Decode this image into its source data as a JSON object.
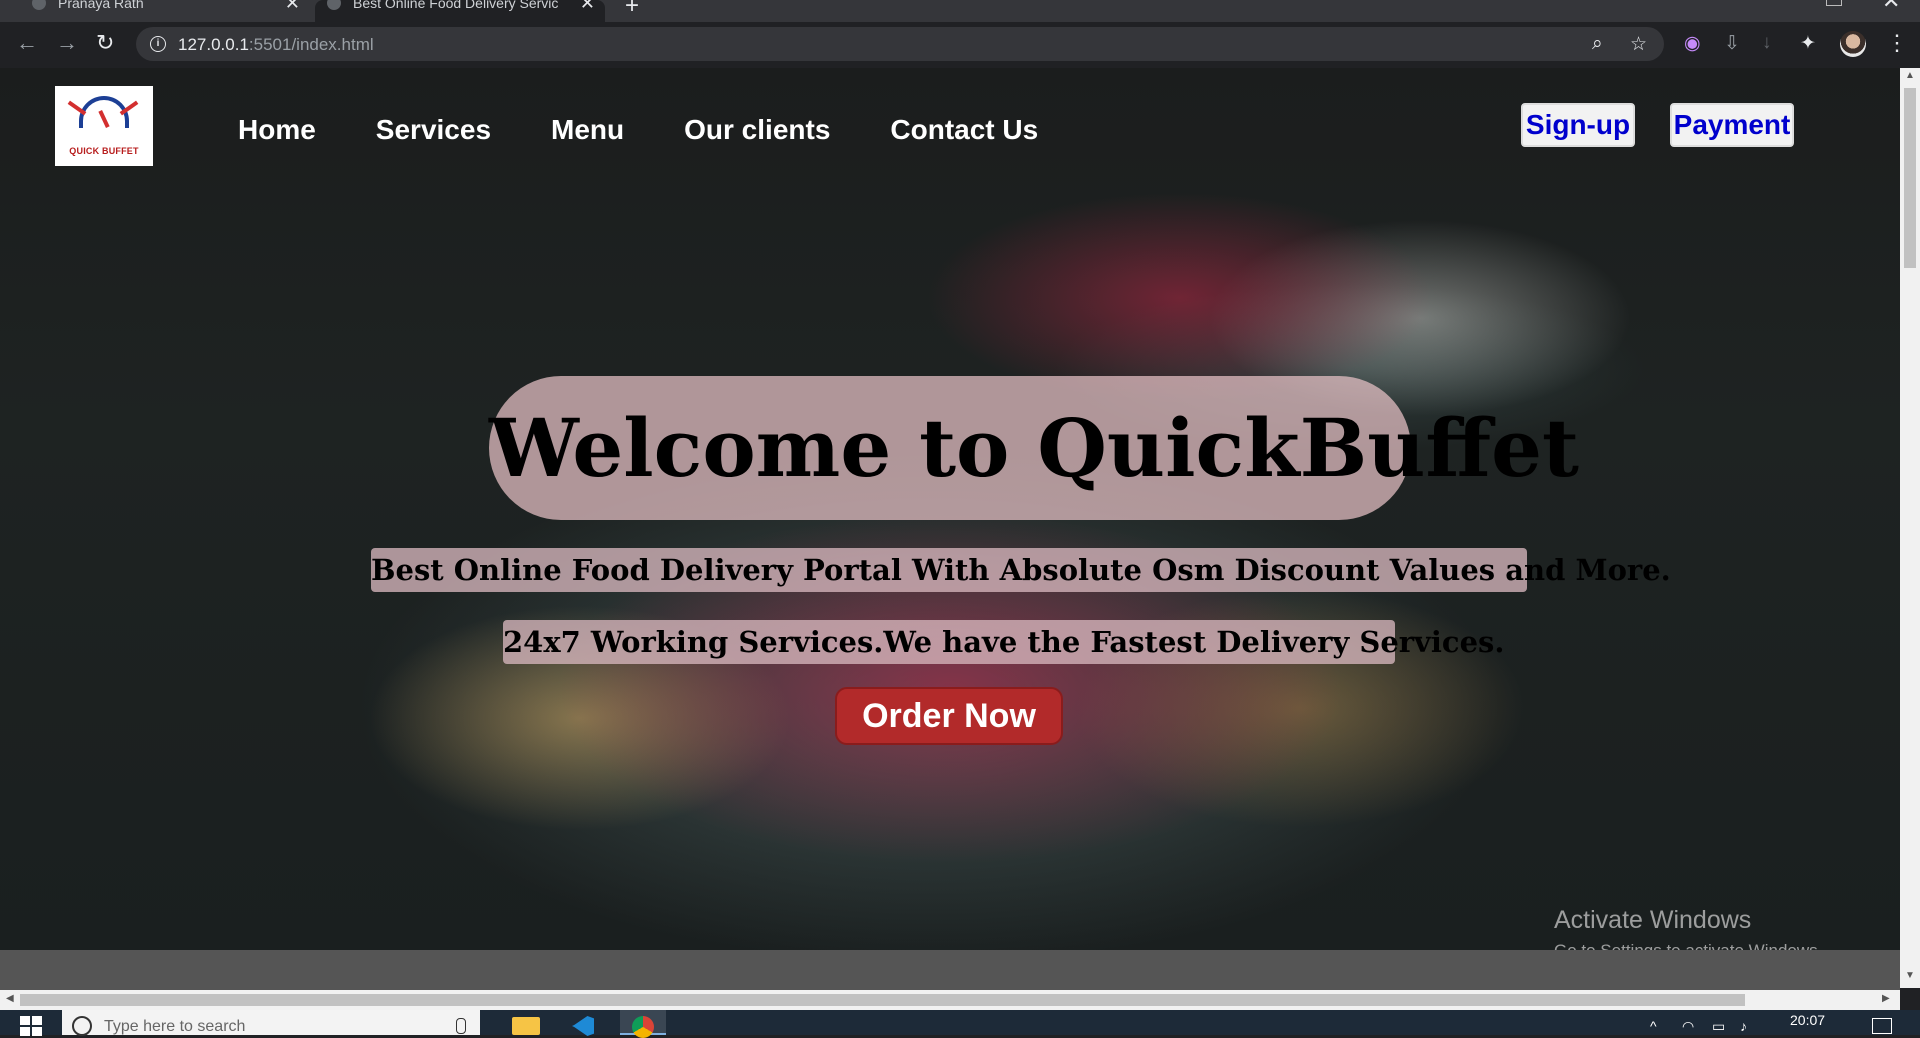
{
  "browser": {
    "tabs": [
      {
        "title": "Pranaya Rath"
      },
      {
        "title": "Best Online Food Delivery Servic"
      }
    ],
    "new_tab": "+",
    "url_host": "127.0.0.1",
    "url_rest": ":5501/index.html",
    "close_glyph": "✕"
  },
  "site": {
    "logo_text": "QUICK BUFFET",
    "nav": [
      "Home",
      "Services",
      "Menu",
      "Our clients",
      "Contact Us"
    ],
    "signup_label": "Sign-up",
    "payment_label": "Payment",
    "hero_title": "Welcome to QuickBuffet",
    "hero_subtitle_1": "Best Online Food Delivery Portal With Absolute Osm Discount Values and More.",
    "hero_subtitle_2": "24x7 Working Services.We have the Fastest Delivery Services.",
    "order_label": "Order Now"
  },
  "watermark": {
    "title": "Activate Windows",
    "subtitle": "Go to Settings to activate Windows."
  },
  "taskbar": {
    "search_placeholder": "Type here to search",
    "clock": "20:07"
  },
  "colors": {
    "nav_text": "#ffffff",
    "button_text": "#0000cd",
    "order_button": "#b22a2a",
    "hero_pill": "#e9c3c8"
  }
}
